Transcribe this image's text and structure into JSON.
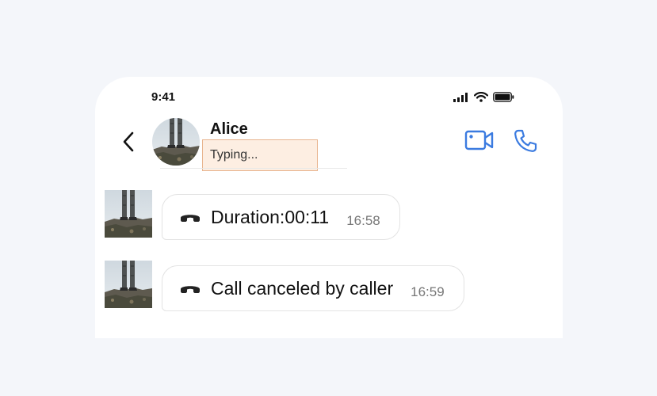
{
  "status_bar": {
    "time": "9:41"
  },
  "header": {
    "contact_name": "Alice",
    "status": "Typing..."
  },
  "messages": [
    {
      "text": "Duration:00:11",
      "time": "16:58",
      "icon": "hangup-phone-icon"
    },
    {
      "text": "Call canceled by caller",
      "time": "16:59",
      "icon": "hangup-phone-icon"
    }
  ],
  "icons": {
    "back": "chevron-left-icon",
    "video_call": "video-camera-icon",
    "voice_call": "phone-icon",
    "signal": "cellular-signal-icon",
    "wifi": "wifi-icon",
    "battery": "battery-icon"
  },
  "colors": {
    "accent": "#3b7be0",
    "typing_highlight": "#fdeee2",
    "typing_border": "#e8b48e",
    "background": "#f4f6fa"
  }
}
